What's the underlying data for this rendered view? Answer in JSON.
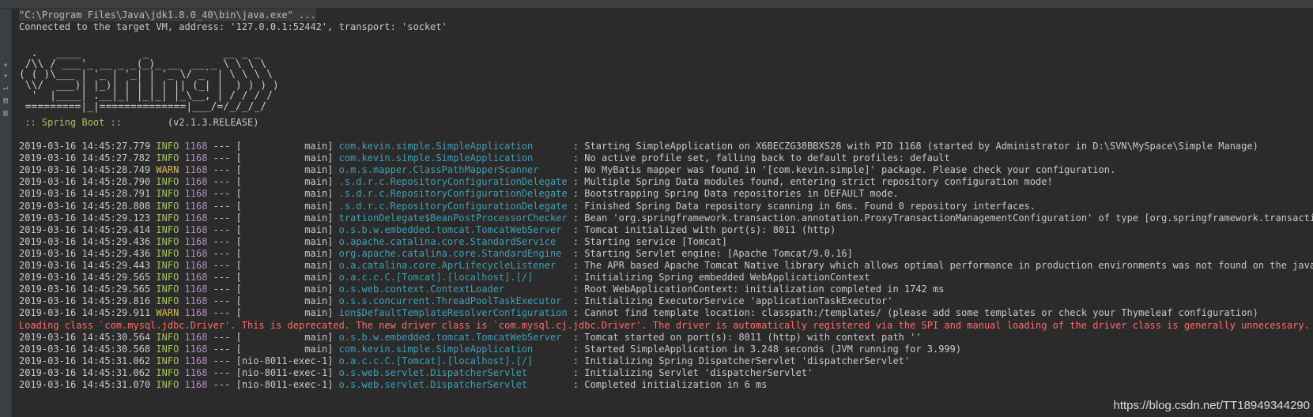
{
  "console": {
    "command": "\"C:\\Program Files\\Java\\jdk1.8.0_40\\bin\\java.exe\" ...",
    "connected": "Connected to the target VM, address: '127.0.0.1:52442', transport: 'socket'"
  },
  "banner": {
    "lines": [
      "  .   ____          _            __ _ _",
      " /\\\\ / ___'_ __ _ _(_)_ __  __ _ \\ \\ \\ \\",
      "( ( )\\___ | '_ | '_| | '_ \\/ _` | \\ \\ \\ \\",
      " \\\\/  ___)| |_)| | | | | || (_| |  ) ) ) )",
      "  '  |____| .__|_| |_|_| |_\\__, | / / / /",
      " =========|_|==============|___/=/_/_/_/"
    ],
    "spring_label": " :: Spring Boot :: ",
    "version": "       (v2.1.3.RELEASE)"
  },
  "logs": [
    {
      "ts": "2019-03-16 14:45:27.779",
      "level": "INFO",
      "pid": "1168",
      "thread": "           main",
      "logger": "com.kevin.simple.SimpleApplication      ",
      "msg": ": Starting SimpleApplication on X6BECZG38BBXS28 with PID 1168 (started by Administrator in D:\\SVN\\MySpace\\Simple Manage)"
    },
    {
      "ts": "2019-03-16 14:45:27.782",
      "level": "INFO",
      "pid": "1168",
      "thread": "           main",
      "logger": "com.kevin.simple.SimpleApplication      ",
      "msg": ": No active profile set, falling back to default profiles: default"
    },
    {
      "ts": "2019-03-16 14:45:28.749",
      "level": "WARN",
      "pid": "1168",
      "thread": "           main",
      "logger": "o.m.s.mapper.ClassPathMapperScanner     ",
      "msg": ": No MyBatis mapper was found in '[com.kevin.simple]' package. Please check your configuration."
    },
    {
      "ts": "2019-03-16 14:45:28.790",
      "level": "INFO",
      "pid": "1168",
      "thread": "           main",
      "logger": ".s.d.r.c.RepositoryConfigurationDelegate",
      "msg": ": Multiple Spring Data modules found, entering strict repository configuration mode!"
    },
    {
      "ts": "2019-03-16 14:45:28.791",
      "level": "INFO",
      "pid": "1168",
      "thread": "           main",
      "logger": ".s.d.r.c.RepositoryConfigurationDelegate",
      "msg": ": Bootstrapping Spring Data repositories in DEFAULT mode."
    },
    {
      "ts": "2019-03-16 14:45:28.808",
      "level": "INFO",
      "pid": "1168",
      "thread": "           main",
      "logger": ".s.d.r.c.RepositoryConfigurationDelegate",
      "msg": ": Finished Spring Data repository scanning in 6ms. Found 0 repository interfaces."
    },
    {
      "ts": "2019-03-16 14:45:29.123",
      "level": "INFO",
      "pid": "1168",
      "thread": "           main",
      "logger": "trationDelegate$BeanPostProcessorChecker",
      "msg": ": Bean 'org.springframework.transaction.annotation.ProxyTransactionManagementConfiguration' of type [org.springframework.transaction.anno"
    },
    {
      "ts": "2019-03-16 14:45:29.414",
      "level": "INFO",
      "pid": "1168",
      "thread": "           main",
      "logger": "o.s.b.w.embedded.tomcat.TomcatWebServer ",
      "msg": ": Tomcat initialized with port(s): 8011 (http)"
    },
    {
      "ts": "2019-03-16 14:45:29.436",
      "level": "INFO",
      "pid": "1168",
      "thread": "           main",
      "logger": "o.apache.catalina.core.StandardService  ",
      "msg": ": Starting service [Tomcat]"
    },
    {
      "ts": "2019-03-16 14:45:29.436",
      "level": "INFO",
      "pid": "1168",
      "thread": "           main",
      "logger": "org.apache.catalina.core.StandardEngine ",
      "msg": ": Starting Servlet engine: [Apache Tomcat/9.0.16]"
    },
    {
      "ts": "2019-03-16 14:45:29.443",
      "level": "INFO",
      "pid": "1168",
      "thread": "           main",
      "logger": "o.a.catalina.core.AprLifecycleListener  ",
      "msg": ": The APR based Apache Tomcat Native library which allows optimal performance in production environments was not found on the java.libra"
    },
    {
      "ts": "2019-03-16 14:45:29.565",
      "level": "INFO",
      "pid": "1168",
      "thread": "           main",
      "logger": "o.a.c.c.C.[Tomcat].[localhost].[/]      ",
      "msg": ": Initializing Spring embedded WebApplicationContext"
    },
    {
      "ts": "2019-03-16 14:45:29.565",
      "level": "INFO",
      "pid": "1168",
      "thread": "           main",
      "logger": "o.s.web.context.ContextLoader           ",
      "msg": ": Root WebApplicationContext: initialization completed in 1742 ms"
    },
    {
      "ts": "2019-03-16 14:45:29.816",
      "level": "INFO",
      "pid": "1168",
      "thread": "           main",
      "logger": "o.s.s.concurrent.ThreadPoolTaskExecutor ",
      "msg": ": Initializing ExecutorService 'applicationTaskExecutor'"
    },
    {
      "ts": "2019-03-16 14:45:29.911",
      "level": "WARN",
      "pid": "1168",
      "thread": "           main",
      "logger": "ion$DefaultTemplateResolverConfiguration",
      "msg": ": Cannot find template location: classpath:/templates/ (please add some templates or check your Thymeleaf configuration)"
    },
    {
      "error": "Loading class `com.mysql.jdbc.Driver'. This is deprecated. The new driver class is `com.mysql.cj.jdbc.Driver'. The driver is automatically registered via the SPI and manual loading of the driver class is generally unnecessary."
    },
    {
      "ts": "2019-03-16 14:45:30.564",
      "level": "INFO",
      "pid": "1168",
      "thread": "           main",
      "logger": "o.s.b.w.embedded.tomcat.TomcatWebServer ",
      "msg": ": Tomcat started on port(s): 8011 (http) with context path ''"
    },
    {
      "ts": "2019-03-16 14:45:30.568",
      "level": "INFO",
      "pid": "1168",
      "thread": "           main",
      "logger": "com.kevin.simple.SimpleApplication      ",
      "msg": ": Started SimpleApplication in 3.248 seconds (JVM running for 3.999)"
    },
    {
      "ts": "2019-03-16 14:45:31.062",
      "level": "INFO",
      "pid": "1168",
      "thread": "nio-8011-exec-1",
      "logger": "o.a.c.c.C.[Tomcat].[localhost].[/]      ",
      "msg": ": Initializing Spring DispatcherServlet 'dispatcherServlet'"
    },
    {
      "ts": "2019-03-16 14:45:31.062",
      "level": "INFO",
      "pid": "1168",
      "thread": "nio-8011-exec-1",
      "logger": "o.s.web.servlet.DispatcherServlet       ",
      "msg": ": Initializing Servlet 'dispatcherServlet'"
    },
    {
      "ts": "2019-03-16 14:45:31.070",
      "level": "INFO",
      "pid": "1168",
      "thread": "nio-8011-exec-1",
      "logger": "o.s.web.servlet.DispatcherServlet       ",
      "msg": ": Completed initialization in 6 ms"
    }
  ],
  "watermark": "https://blog.csdn.net/TT18949344290",
  "colors": {
    "background": "#2b2b2b",
    "text": "#bbbbbb",
    "info": "#a5c261",
    "warn": "#d6bf55",
    "pid": "#b58fc4",
    "logger": "#3f9fb7",
    "error": "#ff6b68"
  },
  "gutter_icons": [
    "scroll-up-icon",
    "scroll-down-icon",
    "soft-wrap-icon",
    "print-icon",
    "clear-all-icon"
  ]
}
